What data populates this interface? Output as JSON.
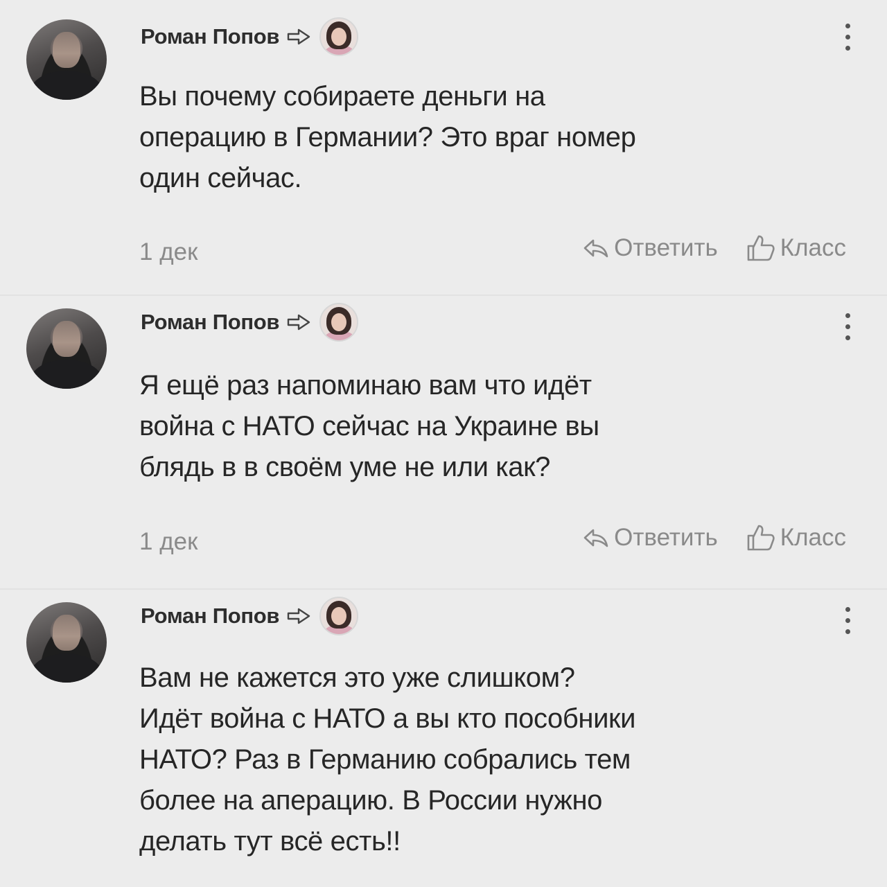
{
  "comments": [
    {
      "author": "Роман Попов",
      "lines": [
        "Вы почему собираете деньги на",
        "операцию в Германии? Это враг номер",
        "один сейчас."
      ],
      "date": "1 дек",
      "reply_label": "Ответить",
      "like_label": "Класс"
    },
    {
      "author": "Роман Попов",
      "lines": [
        "Я ещё раз напоминаю вам что идёт",
        "война с НАТО сейчас на Украине вы",
        "блядь в в своём уме не или как?"
      ],
      "date": "1 дек",
      "reply_label": "Ответить",
      "like_label": "Класс"
    },
    {
      "author": "Роман Попов",
      "lines": [
        "Вам не кажется это уже слишком?",
        "Идёт война с НАТО а вы кто пособники",
        "НАТО? Раз в Германию собрались тем",
        "более на аперацию. В России нужно",
        "делать тут всё есть!!"
      ]
    }
  ],
  "icons": {
    "reply_to": "reply-arrow-icon",
    "reply": "reply-icon",
    "like": "thumbs-up-icon",
    "menu": "more-vertical-icon"
  },
  "colors": {
    "background": "#ececec",
    "text": "#262626",
    "muted": "#8a8a8a"
  }
}
